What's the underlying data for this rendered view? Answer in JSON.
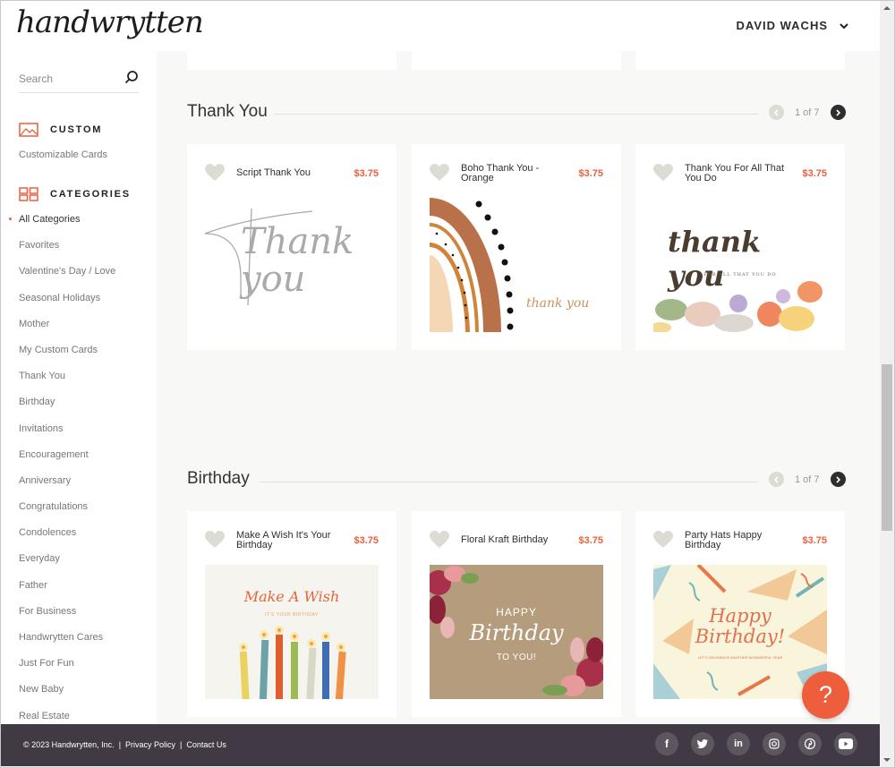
{
  "header": {
    "logo": "handwrytten",
    "user_name": "DAVID WACHS"
  },
  "sidebar": {
    "search_placeholder": "Search",
    "custom": {
      "heading": "CUSTOM",
      "link": "Customizable Cards"
    },
    "categories": {
      "heading": "CATEGORIES",
      "items": [
        {
          "label": "All Categories",
          "active": true
        },
        {
          "label": "Favorites"
        },
        {
          "label": "Valentine's Day / Love"
        },
        {
          "label": "Seasonal Holidays"
        },
        {
          "label": "Mother"
        },
        {
          "label": "My Custom Cards"
        },
        {
          "label": "Thank You"
        },
        {
          "label": "Birthday"
        },
        {
          "label": "Invitations"
        },
        {
          "label": "Encouragement"
        },
        {
          "label": "Anniversary"
        },
        {
          "label": "Congratulations"
        },
        {
          "label": "Condolences"
        },
        {
          "label": "Everyday"
        },
        {
          "label": "Father"
        },
        {
          "label": "For Business"
        },
        {
          "label": "Handwrytten Cares"
        },
        {
          "label": "Just For Fun"
        },
        {
          "label": "New Baby"
        },
        {
          "label": "Real Estate"
        }
      ]
    }
  },
  "sections": [
    {
      "title": "Thank You",
      "pager": "1 of 7",
      "cards": [
        {
          "title": "Script Thank You",
          "price": "$3.75",
          "art_text": "Thank you"
        },
        {
          "title": "Boho Thank You - Orange",
          "price": "$3.75",
          "art_text": "thank you"
        },
        {
          "title": "Thank You For All That You Do",
          "price": "$3.75",
          "art_text": "thank you",
          "art_sub": "FOR ALL THAT YOU DO"
        }
      ]
    },
    {
      "title": "Birthday",
      "pager": "1 of 7",
      "cards": [
        {
          "title": "Make A Wish It's Your Birthday",
          "price": "$3.75",
          "art_text": "Make A Wish",
          "art_sub": "IT'S YOUR BIRTHDAY"
        },
        {
          "title": "Floral Kraft Birthday",
          "price": "$3.75",
          "art_top": "HAPPY",
          "art_text": "Birthday",
          "art_sub": "TO YOU!"
        },
        {
          "title": "Party Hats Happy Birthday",
          "price": "$3.75",
          "art_top": "Happy",
          "art_text": "Birthday!",
          "art_sub": "LET'S CELEBRATE ANOTHER WONDERFUL YEAR"
        }
      ]
    }
  ],
  "footer": {
    "copyright": "© 2023 Handwrytten, Inc.",
    "separator": "|",
    "privacy": "Privacy Policy",
    "contact": "Contact Us",
    "socials": [
      "facebook-icon",
      "twitter-icon",
      "linkedin-icon",
      "instagram-icon",
      "pinterest-icon",
      "youtube-icon"
    ]
  },
  "help_button": "?",
  "colors": {
    "accent": "#ee5d3c",
    "footer_bg": "#413a44",
    "heart": "#dcdcd4",
    "page_bg": "#f8f8f6"
  }
}
